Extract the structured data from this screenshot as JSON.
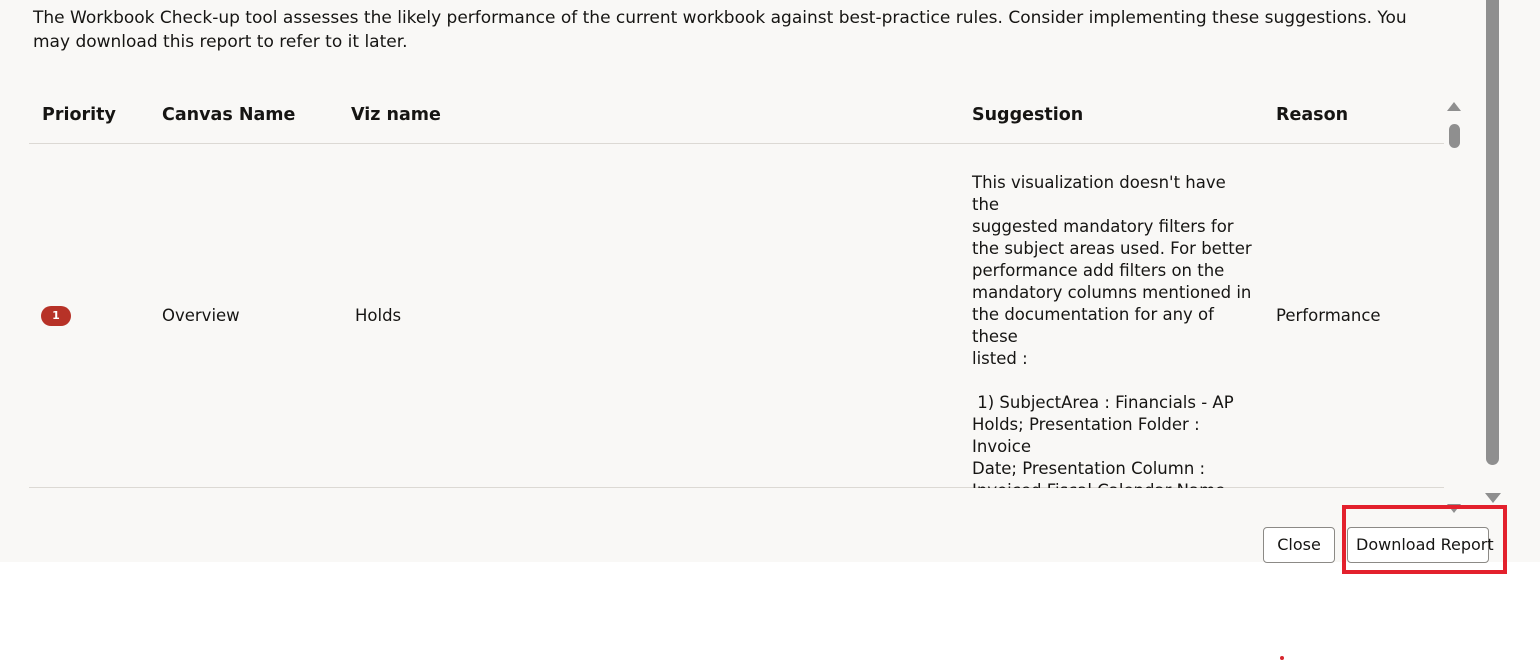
{
  "intro_text": "The Workbook Check-up tool assesses the likely performance of the current workbook against best-practice rules. Consider implementing these suggestions. You may download this report to refer to it later.",
  "table": {
    "headers": {
      "priority": "Priority",
      "canvas_name": "Canvas Name",
      "viz_name": "Viz name",
      "suggestion": "Suggestion",
      "reason": "Reason"
    },
    "rows": [
      {
        "priority": "1",
        "canvas_name": "Overview",
        "viz_name": "Holds",
        "suggestion": "This visualization doesn't have the\nsuggested mandatory filters for\nthe subject areas used. For better\nperformance add filters on the\nmandatory columns mentioned in\nthe documentation for any of these\nlisted :\n\n 1) SubjectArea : Financials - AP\nHolds; Presentation Folder : Invoice\nDate; Presentation Column :\nInvoiced Fiscal Calendar Name",
        "reason": "Performance"
      }
    ]
  },
  "buttons": {
    "close": "Close",
    "download_report": "Download Report"
  },
  "colors": {
    "priority_badge": "#b73227",
    "highlight_box": "#e3212d",
    "dialog_background": "#f9f8f6"
  },
  "icons": {
    "scroll_up": "triangle-up-icon",
    "scroll_down": "triangle-down-icon"
  }
}
